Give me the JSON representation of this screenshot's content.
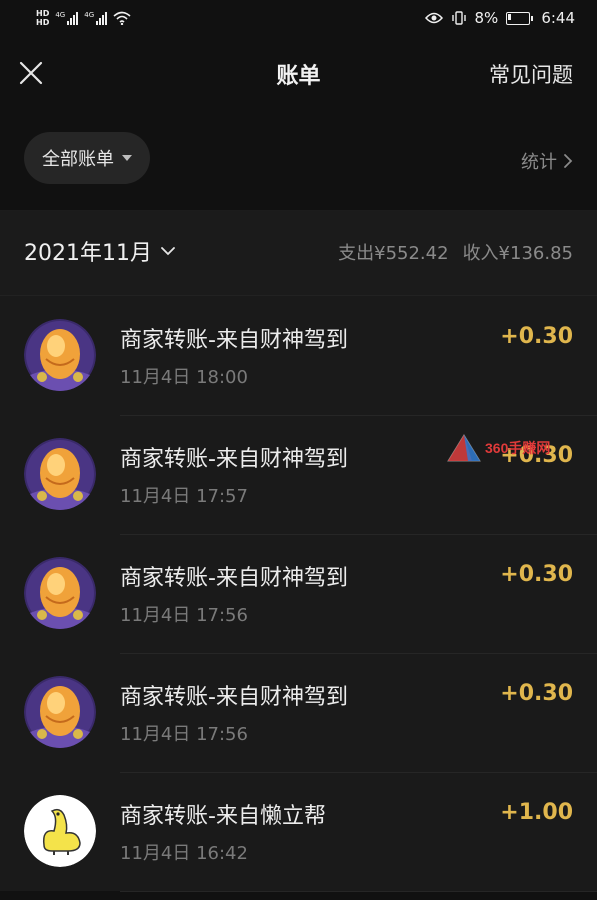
{
  "status_bar": {
    "hd_top": "HD",
    "hd_bottom": "HD",
    "net1": "4G",
    "net2": "4G",
    "battery_pct": "8%",
    "time": "6:44",
    "icons": [
      "eye-icon",
      "vibrate-icon",
      "wifi-icon",
      "battery-icon"
    ]
  },
  "nav": {
    "title": "账单",
    "right_link": "常见问题"
  },
  "filter": {
    "label": "全部账单",
    "stats_label": "统计"
  },
  "month": {
    "label": "2021年11月",
    "expense": "支出¥552.42",
    "income": "收入¥136.85"
  },
  "bills": [
    {
      "title": "商家转账-来自财神驾到",
      "time": "11月4日 18:00",
      "amount": "+0.30",
      "avatar": "golden-egg"
    },
    {
      "title": "商家转账-来自财神驾到",
      "time": "11月4日 17:57",
      "amount": "+0.30",
      "avatar": "golden-egg"
    },
    {
      "title": "商家转账-来自财神驾到",
      "time": "11月4日 17:56",
      "amount": "+0.30",
      "avatar": "golden-egg"
    },
    {
      "title": "商家转账-来自财神驾到",
      "time": "11月4日 17:56",
      "amount": "+0.30",
      "avatar": "golden-egg"
    },
    {
      "title": "商家转账-来自懒立帮",
      "time": "11月4日 16:42",
      "amount": "+1.00",
      "avatar": "yellow-dinosaur"
    }
  ],
  "watermark": "360手赚网",
  "colors": {
    "background": "#111111",
    "list_background": "#1a1a1a",
    "amount": "#e0b64d",
    "secondary_text": "#8a8a8a"
  }
}
